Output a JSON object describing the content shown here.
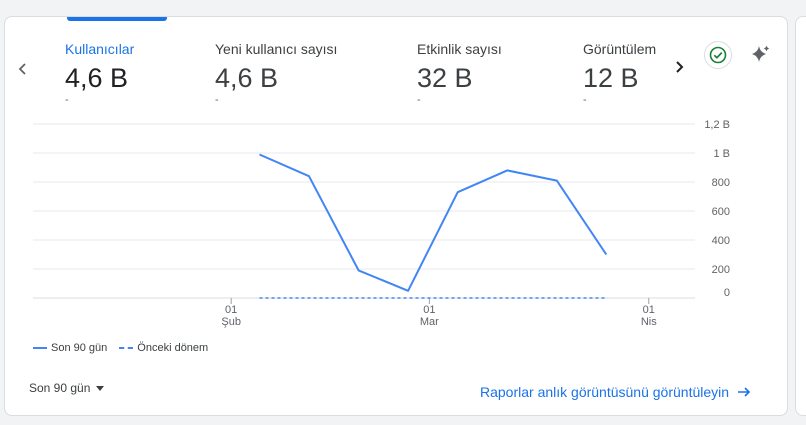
{
  "metrics": [
    {
      "label": "Kullanıcılar",
      "value": "4,6 B",
      "delta": "-"
    },
    {
      "label": "Yeni kullanıcı sayısı",
      "value": "4,6 B",
      "delta": "-"
    },
    {
      "label": "Etkinlik sayısı",
      "value": "32 B",
      "delta": "-"
    },
    {
      "label": "Görüntülem",
      "value": "12 B",
      "delta": "-"
    }
  ],
  "legend": {
    "current": "Son 90 gün",
    "previous": "Önceki dönem"
  },
  "range_select": {
    "label": "Son 90 gün"
  },
  "report_link": {
    "label": "Raporlar anlık görüntüsünü görüntüleyin"
  },
  "colors": {
    "accent": "#1a73e8",
    "series": "#4285f4",
    "check": "#188038",
    "grid": "#e8eaed"
  },
  "icons": [
    "chevron-left-icon",
    "chevron-right-icon",
    "check-circle-icon",
    "sparkle-icon",
    "arrow-right-icon",
    "caret-down-icon"
  ],
  "chart_data": {
    "type": "line",
    "title": "",
    "xlabel": "",
    "ylabel": "",
    "ylim": [
      0,
      1200
    ],
    "yticks": [
      {
        "value": 0,
        "label": "0"
      },
      {
        "value": 200,
        "label": "200"
      },
      {
        "value": 400,
        "label": "400"
      },
      {
        "value": 600,
        "label": "600"
      },
      {
        "value": 800,
        "label": "800"
      },
      {
        "value": 1000,
        "label": "1 B"
      },
      {
        "value": 1200,
        "label": "1,2 B"
      }
    ],
    "xticks": [
      {
        "day": 1,
        "label": [
          "01",
          "Şub"
        ]
      },
      {
        "day": 29,
        "label": [
          "01",
          "Mar"
        ]
      },
      {
        "day": 60,
        "label": [
          "01",
          "Nis"
        ]
      }
    ],
    "xlim": [
      -27,
      63
    ],
    "grid": true,
    "legend_position": "bottom-left",
    "series": [
      {
        "name": "Son 90 gün",
        "style": "solid",
        "x": [
          5,
          12,
          19,
          26,
          33,
          40,
          47,
          54
        ],
        "y": [
          990,
          840,
          190,
          50,
          730,
          880,
          810,
          300
        ]
      },
      {
        "name": "Önceki dönem",
        "style": "dashed",
        "x": [
          5,
          54
        ],
        "y": [
          0,
          0
        ]
      }
    ]
  }
}
